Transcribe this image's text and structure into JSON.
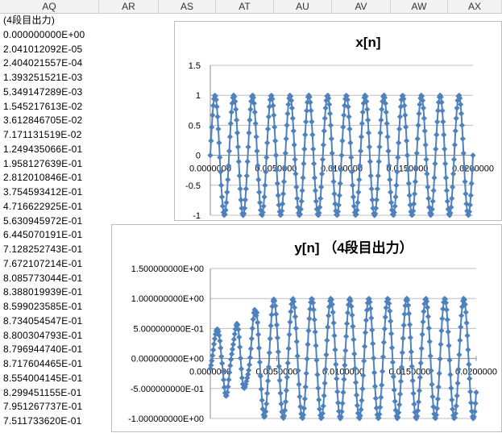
{
  "columns": [
    "AQ",
    "AR",
    "AS",
    "AT",
    "AU",
    "AV",
    "AW",
    "AX"
  ],
  "cells": [
    "(4段目出力)",
    "0.000000000E+00",
    "2.041012092E-05",
    "2.404021557E-04",
    "1.393251521E-03",
    "5.349147289E-03",
    "1.545217613E-02",
    "3.612846705E-02",
    "7.171131519E-02",
    "1.249435066E-01",
    "1.958127639E-01",
    "2.812010846E-01",
    "3.754593412E-01",
    "4.716622925E-01",
    "5.630945972E-01",
    "6.445070191E-01",
    "7.128252743E-01",
    "7.672107214E-01",
    "8.085773044E-01",
    "8.388019939E-01",
    "8.599023585E-01",
    "8.734054547E-01",
    "8.800304793E-01",
    "8.796944740E-01",
    "8.717604465E-01",
    "8.554004145E-01",
    "8.299451155E-01",
    "7.951267737E-01",
    "7.511733620E-01"
  ],
  "chart_data": [
    {
      "type": "scatter",
      "title": "x[n]",
      "series_color": "#4f81bd",
      "xlim": [
        0,
        0.02
      ],
      "ylim": [
        -1,
        1.5
      ],
      "yticks": [
        "1.5",
        "1",
        "0.5",
        "0",
        "-0.5",
        "-1"
      ],
      "ytick_values": [
        1.5,
        1,
        0.5,
        0,
        -0.5,
        -1
      ],
      "xticks": [
        "0.0000000",
        "0.0050000",
        "0.0100000",
        "0.0150000",
        "0.0200000"
      ],
      "xtick_values": [
        0,
        0.005,
        0.01,
        0.015,
        0.02
      ],
      "frequency_hz": 700
    },
    {
      "type": "scatter",
      "title": "y[n] （4段目出力）",
      "series_color": "#4f81bd",
      "xlim": [
        0,
        0.02
      ],
      "ylim": [
        -1,
        1.5
      ],
      "yticks": [
        "1.500000000E+00",
        "1.000000000E+00",
        "5.000000000E-01",
        "0.000000000E+00",
        "-5.000000000E-01",
        "-1.000000000E+00"
      ],
      "ytick_values": [
        1.5,
        1,
        0.5,
        0,
        -0.5,
        -1
      ],
      "xticks": [
        "0.0000000",
        "0.0050000",
        "0.0100000",
        "0.0150000",
        "0.0200000"
      ],
      "xtick_values": [
        0,
        0.005,
        0.01,
        0.015,
        0.02
      ],
      "frequency_hz": 700
    }
  ]
}
